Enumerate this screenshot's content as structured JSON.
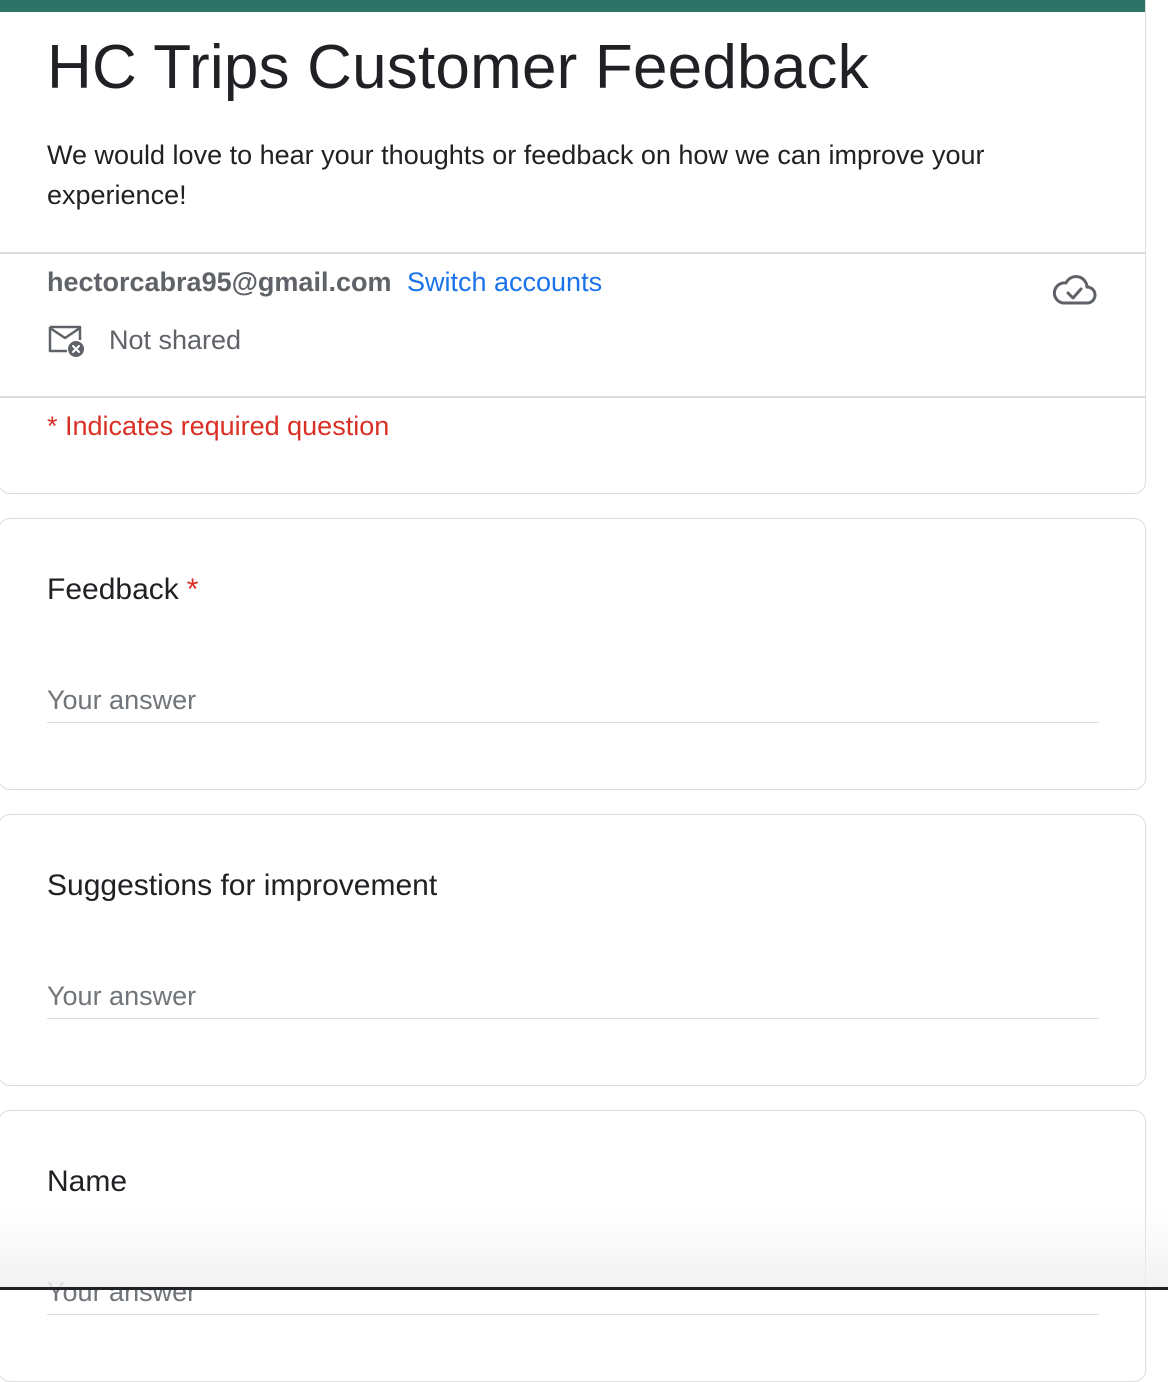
{
  "form": {
    "title": "HC Trips Customer Feedback",
    "description": "We would love to hear your thoughts or feedback on how we can improve your experience!",
    "accent_color": "#2e7466"
  },
  "account": {
    "email": "hectorcabra95@gmail.com",
    "switch_label": "Switch accounts",
    "share_status": "Not shared",
    "cloud_icon": "cloud-saved-icon",
    "share_icon": "mail-not-shared-icon"
  },
  "required_note": "* Indicates required question",
  "questions": [
    {
      "title": "Feedback",
      "required_mark": "*",
      "placeholder": "Your answer"
    },
    {
      "title": "Suggestions for improvement",
      "placeholder": "Your answer"
    },
    {
      "title": "Name",
      "placeholder": "Your answer"
    }
  ],
  "colors": {
    "link": "#1a73e8",
    "required": "#d93025",
    "border": "#dadce0",
    "muted_text": "#5f6368"
  }
}
